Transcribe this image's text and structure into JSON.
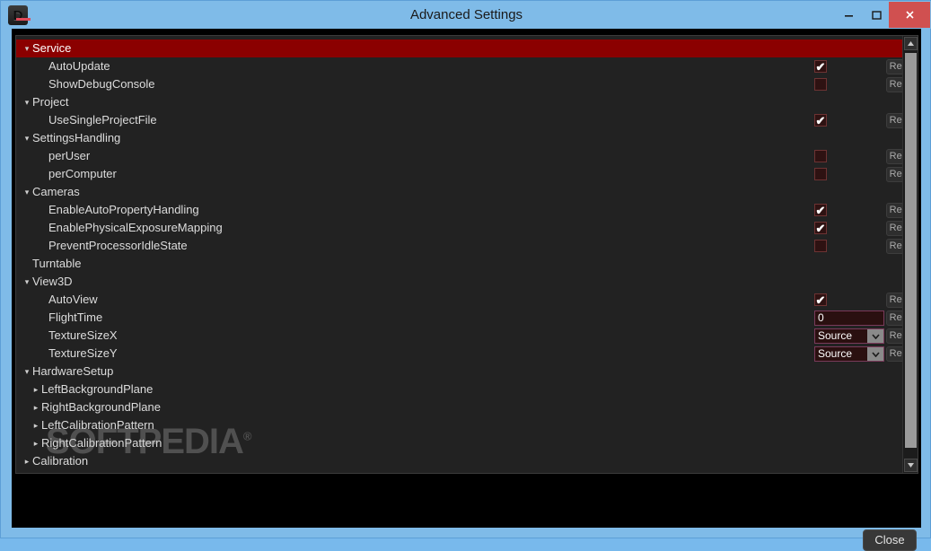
{
  "window": {
    "title": "Advanced Settings",
    "icon": "app-icon",
    "controls": {
      "minimize": "minimize-icon",
      "maximize": "maximize-icon",
      "close": "close-icon"
    }
  },
  "watermark": {
    "text": "SOFTPEDIA",
    "mark": "®"
  },
  "footer": {
    "close_label": "Close"
  },
  "scrollbar": {
    "up": "▲",
    "down": "▼"
  },
  "glyphs": {
    "expanded": "▾",
    "collapsed": "▸",
    "checkmark": "✔",
    "chevron_down": "⌄"
  },
  "colors": {
    "titlebar": "#7fbbe8",
    "close_button": "#d05050",
    "selection": "#8b0000",
    "panel_bg": "#222222",
    "field_bg": "#2a1010"
  },
  "rows": [
    {
      "label": "Service",
      "level": 0,
      "tri": "expanded",
      "selected": true,
      "control": "none"
    },
    {
      "label": "AutoUpdate",
      "level": 2,
      "tri": "none",
      "selected": false,
      "control": "checkbox",
      "checked": true,
      "reset": "Reset"
    },
    {
      "label": "ShowDebugConsole",
      "level": 2,
      "tri": "none",
      "selected": false,
      "control": "checkbox",
      "checked": false,
      "reset": "Reset"
    },
    {
      "label": "Project",
      "level": 0,
      "tri": "expanded",
      "selected": false,
      "control": "none"
    },
    {
      "label": "UseSingleProjectFile",
      "level": 2,
      "tri": "none",
      "selected": false,
      "control": "checkbox",
      "checked": true,
      "reset": "Reset"
    },
    {
      "label": "SettingsHandling",
      "level": 0,
      "tri": "expanded",
      "selected": false,
      "control": "none"
    },
    {
      "label": "perUser",
      "level": 2,
      "tri": "none",
      "selected": false,
      "control": "checkbox",
      "checked": false,
      "reset": "Reset"
    },
    {
      "label": "perComputer",
      "level": 2,
      "tri": "none",
      "selected": false,
      "control": "checkbox",
      "checked": false,
      "reset": "Reset"
    },
    {
      "label": "Cameras",
      "level": 0,
      "tri": "expanded",
      "selected": false,
      "control": "none"
    },
    {
      "label": "EnableAutoPropertyHandling",
      "level": 2,
      "tri": "none",
      "selected": false,
      "control": "checkbox",
      "checked": true,
      "reset": "Reset"
    },
    {
      "label": "EnablePhysicalExposureMapping",
      "level": 2,
      "tri": "none",
      "selected": false,
      "control": "checkbox",
      "checked": true,
      "reset": "Reset"
    },
    {
      "label": "PreventProcessorIdleState",
      "level": 2,
      "tri": "none",
      "selected": false,
      "control": "checkbox",
      "checked": false,
      "reset": "Reset"
    },
    {
      "label": "Turntable",
      "level": 0,
      "tri": "none",
      "selected": false,
      "control": "none"
    },
    {
      "label": "View3D",
      "level": 0,
      "tri": "expanded",
      "selected": false,
      "control": "none"
    },
    {
      "label": "AutoView",
      "level": 2,
      "tri": "none",
      "selected": false,
      "control": "checkbox",
      "checked": true,
      "reset": "Reset"
    },
    {
      "label": "FlightTime",
      "level": 2,
      "tri": "none",
      "selected": false,
      "control": "text",
      "value": "0",
      "reset": "Reset"
    },
    {
      "label": "TextureSizeX",
      "level": 2,
      "tri": "none",
      "selected": false,
      "control": "select",
      "value": "Source",
      "reset": "Reset"
    },
    {
      "label": "TextureSizeY",
      "level": 2,
      "tri": "none",
      "selected": false,
      "control": "select",
      "value": "Source",
      "reset": "Reset"
    },
    {
      "label": "HardwareSetup",
      "level": 0,
      "tri": "expanded",
      "selected": false,
      "control": "none"
    },
    {
      "label": "LeftBackgroundPlane",
      "level": 1,
      "tri": "collapsed",
      "selected": false,
      "control": "none"
    },
    {
      "label": "RightBackgroundPlane",
      "level": 1,
      "tri": "collapsed",
      "selected": false,
      "control": "none"
    },
    {
      "label": "LeftCalibrationPattern",
      "level": 1,
      "tri": "collapsed",
      "selected": false,
      "control": "none"
    },
    {
      "label": "RightCalibrationPattern",
      "level": 1,
      "tri": "collapsed",
      "selected": false,
      "control": "none"
    },
    {
      "label": "Calibration",
      "level": 0,
      "tri": "collapsed",
      "selected": false,
      "control": "none"
    }
  ]
}
